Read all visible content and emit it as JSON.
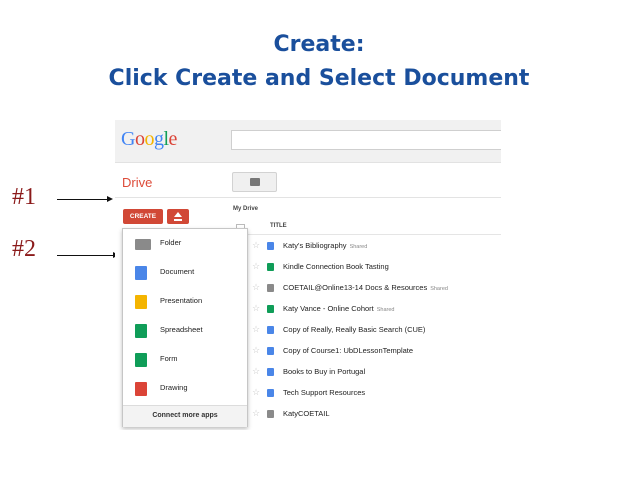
{
  "slide": {
    "title_line1": "Create:",
    "title_line2": "Click Create and Select Document",
    "marker_1": "#1",
    "marker_2": "#2"
  },
  "header": {
    "logo": "Google"
  },
  "sidebar": {
    "app_name": "Drive",
    "create_label": "CREATE"
  },
  "main": {
    "section": "My Drive",
    "column_title": "TITLE",
    "files": [
      {
        "name": "Katy's Bibliography",
        "shared": "Shared",
        "icon": "doc-icon",
        "color": "#4a86e8"
      },
      {
        "name": "Kindle Connection Book Tasting",
        "shared": "",
        "icon": "form-icon",
        "color": "#0f9d58"
      },
      {
        "name": "COETAIL@Online13-14 Docs & Resources",
        "shared": "Shared",
        "icon": "shared-folder-icon",
        "color": "#8a8a8a"
      },
      {
        "name": "Katy Vance - Online Cohort",
        "shared": "Shared",
        "icon": "spreadsheet-icon",
        "color": "#0f9d58"
      },
      {
        "name": "Copy of Really, Really Basic Search (CUE)",
        "shared": "",
        "icon": "doc-icon",
        "color": "#4a86e8"
      },
      {
        "name": "Copy of Course1: UbDLessonTemplate",
        "shared": "",
        "icon": "doc-icon",
        "color": "#4a86e8"
      },
      {
        "name": "Books to Buy in Portugal",
        "shared": "",
        "icon": "doc-icon",
        "color": "#4a86e8"
      },
      {
        "name": "Tech Support Resources",
        "shared": "",
        "icon": "doc-icon",
        "color": "#4a86e8"
      },
      {
        "name": "KatyCOETAIL",
        "shared": "",
        "icon": "folder-icon",
        "color": "#8a8a8a"
      }
    ]
  },
  "create_menu": {
    "items": [
      {
        "label": "Folder",
        "icon": "folder-icon",
        "color": "#8a8a8a"
      },
      {
        "label": "Document",
        "icon": "document-icon",
        "color": "#4a86e8"
      },
      {
        "label": "Presentation",
        "icon": "presentation-icon",
        "color": "#f4b400"
      },
      {
        "label": "Spreadsheet",
        "icon": "spreadsheet-icon",
        "color": "#0f9d58"
      },
      {
        "label": "Form",
        "icon": "form-icon",
        "color": "#0f9d58"
      },
      {
        "label": "Drawing",
        "icon": "drawing-icon",
        "color": "#db4437"
      }
    ],
    "footer": "Connect more apps"
  }
}
